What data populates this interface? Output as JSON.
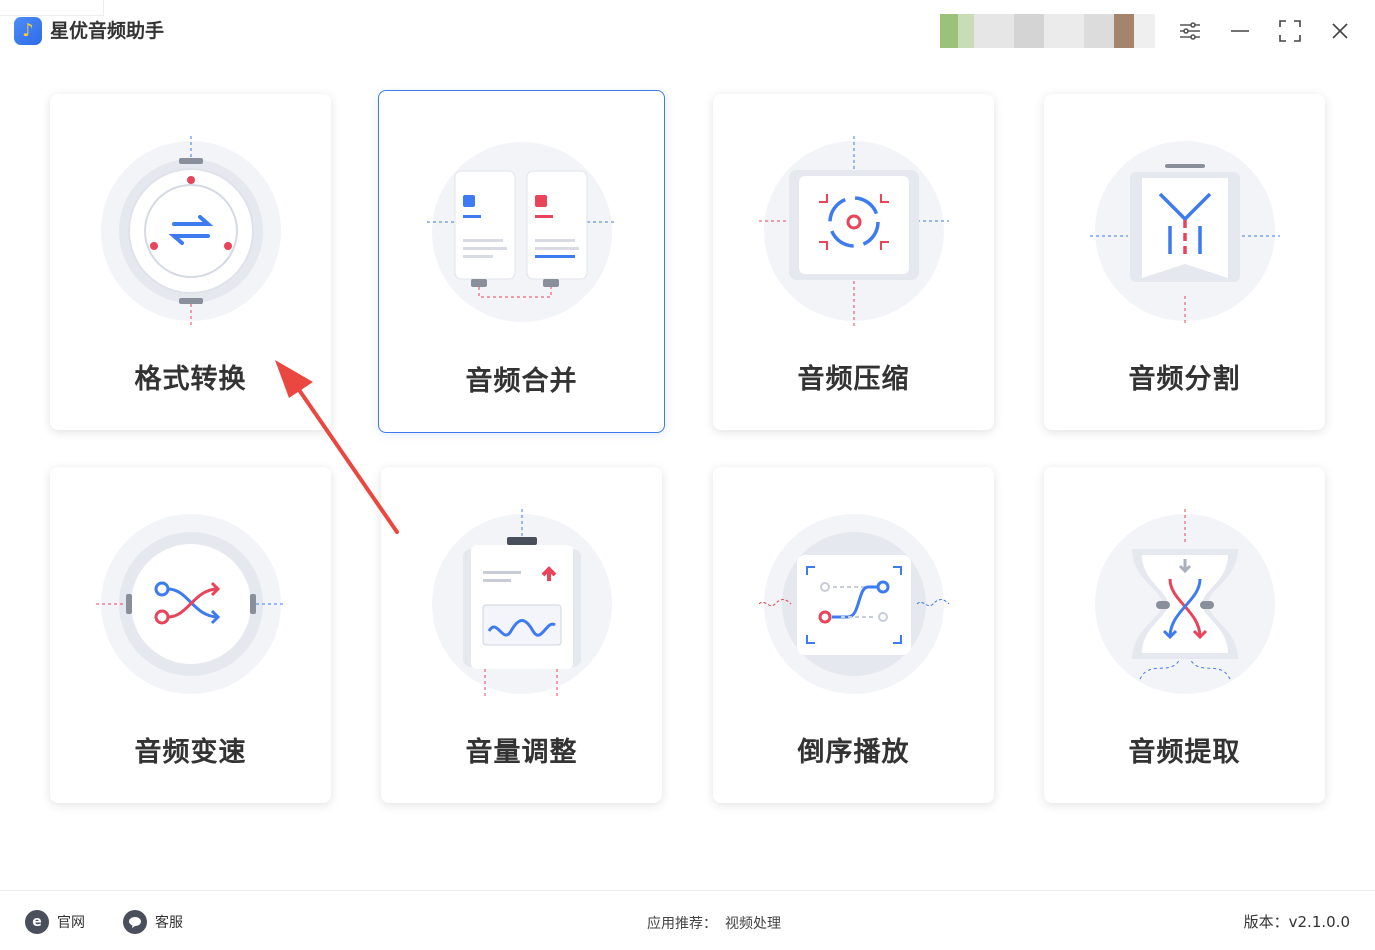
{
  "app": {
    "title": "星优音频助手",
    "logo_icon": "music-note-icon"
  },
  "window_controls": [
    "settings-sliders-icon",
    "minimize-icon",
    "maximize-icon",
    "close-icon"
  ],
  "cards": [
    {
      "label": "格式转换",
      "icon": "format-convert-icon"
    },
    {
      "label": "音频合并",
      "icon": "audio-merge-icon"
    },
    {
      "label": "音频压缩",
      "icon": "audio-compress-icon"
    },
    {
      "label": "音频分割",
      "icon": "audio-split-icon"
    },
    {
      "label": "音频变速",
      "icon": "audio-speed-icon"
    },
    {
      "label": "音量调整",
      "icon": "volume-adjust-icon"
    },
    {
      "label": "倒序播放",
      "icon": "reverse-play-icon"
    },
    {
      "label": "音频提取",
      "icon": "audio-extract-icon"
    }
  ],
  "footer": {
    "website_label": "官网",
    "website_icon_glyph": "e",
    "support_label": "客服",
    "recommend_prefix": "应用推荐：",
    "recommend_link": "视频处理",
    "version": "版本：v2.1.0.0"
  },
  "colors": {
    "accent": "#3e7bf0",
    "red": "#e8445a",
    "arrow": "#e9473f"
  }
}
